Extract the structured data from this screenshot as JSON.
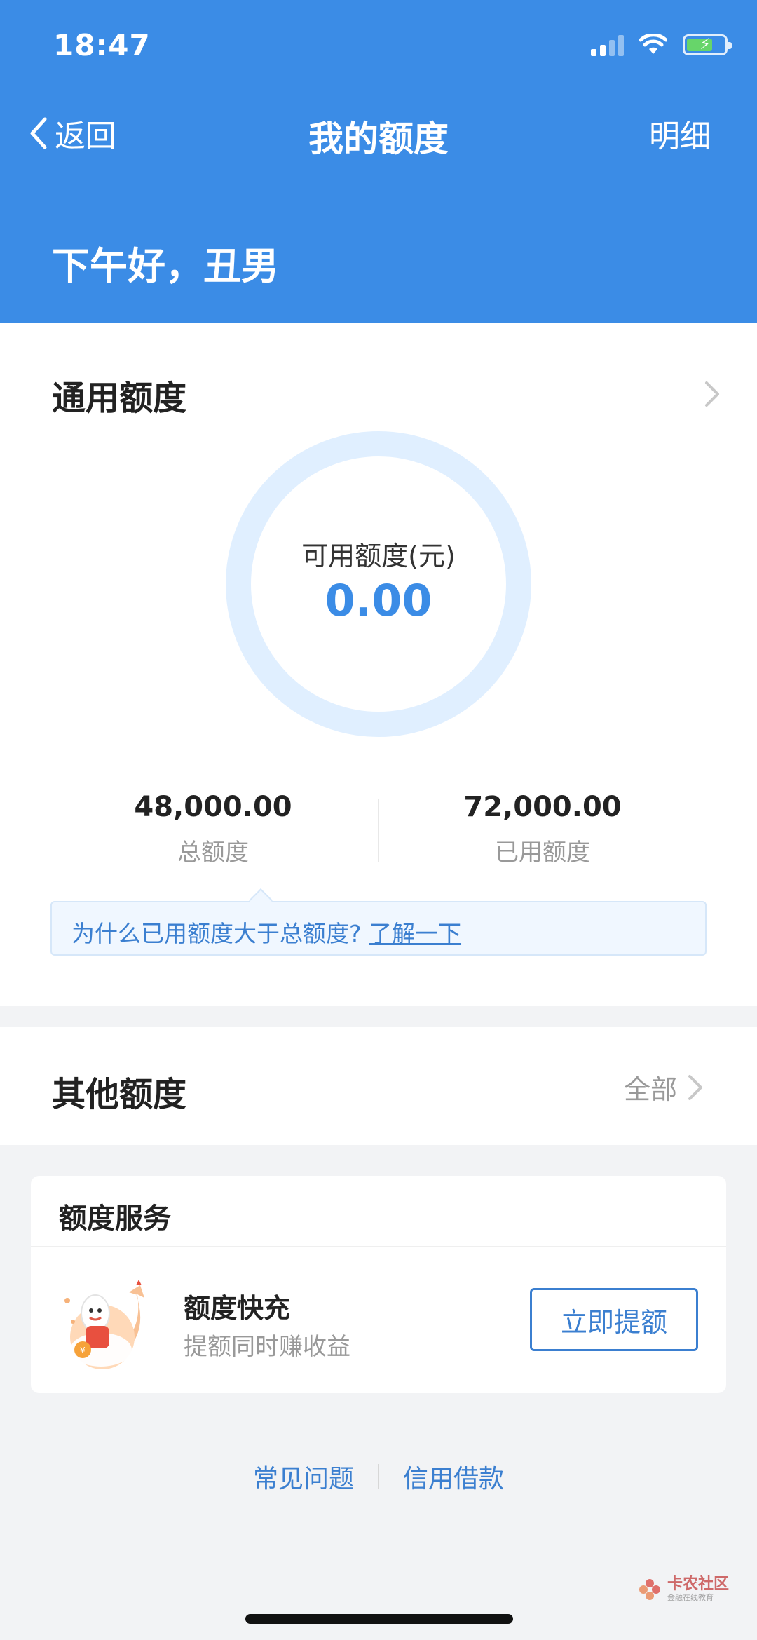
{
  "status_bar": {
    "time": "18:47",
    "icons": [
      "cellular-signal-icon",
      "wifi-icon",
      "battery-charging-icon"
    ]
  },
  "nav": {
    "back_label": "返回",
    "title": "我的额度",
    "right_label": "明细"
  },
  "greeting": "下午好，丑男",
  "general_credit": {
    "title": "通用额度",
    "available_label": "可用额度(元)",
    "available_value": "0.00",
    "total_value": "48,000.00",
    "total_label": "总额度",
    "used_value": "72,000.00",
    "used_label": "已用额度",
    "tip_text": "为什么已用额度大于总额度?",
    "tip_link": "了解一下"
  },
  "other_credit": {
    "title": "其他额度",
    "all_label": "全部"
  },
  "credit_service": {
    "title": "额度服务",
    "item_name": "额度快充",
    "item_desc": "提额同时赚收益",
    "button_label": "立即提额"
  },
  "footer": {
    "link1": "常见问题",
    "link2": "信用借款"
  },
  "watermark": {
    "title": "卡农社区",
    "subtitle": "金融在线教育"
  },
  "colors": {
    "header_blue": "#3b8ce6",
    "accent_blue": "#3b7fd0",
    "ring_light": "#e0efff",
    "page_bg": "#f2f3f5"
  }
}
